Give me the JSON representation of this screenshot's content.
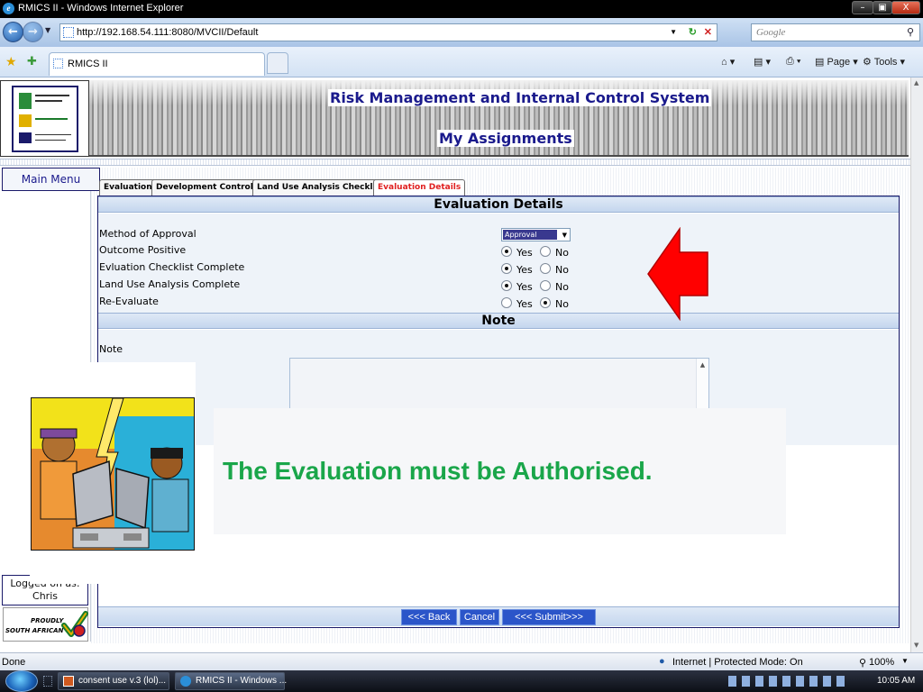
{
  "browser": {
    "window_title": "RMICS II - Windows Internet Explorer",
    "url": "http://192.168.54.111:8080/MVCII/Default",
    "search_placeholder": "Google",
    "tab_title": "RMICS II",
    "toolbar": {
      "page_label": "Page",
      "tools_label": "Tools"
    },
    "status": {
      "left": "Done",
      "zone": "Internet | Protected Mode: On",
      "zoom": "100%"
    }
  },
  "header": {
    "system_title": "Risk Management and Internal Control System",
    "page_title": "My Assignments"
  },
  "sidebar": {
    "main_menu": "Main Menu",
    "logged_on_label": "Logged on as:",
    "user": "Chris",
    "badge": {
      "line1": "PROUDLY",
      "line2": "SOUTH AFRICAN"
    }
  },
  "tabs": [
    {
      "label": "Evaluation",
      "active": false
    },
    {
      "label": "Development Controls",
      "active": false
    },
    {
      "label": "Land Use Analysis Checklist",
      "active": false
    },
    {
      "label": "Evaluation Details",
      "active": true
    }
  ],
  "evaluation_details": {
    "section_title": "Evaluation Details",
    "method_label": "Method of Approval",
    "method_value": "Approval",
    "yes_label": "Yes",
    "no_label": "No",
    "questions": [
      {
        "label": "Outcome Positive",
        "value": "Yes"
      },
      {
        "label": "Evluation Checklist Complete",
        "value": "Yes"
      },
      {
        "label": "Land Use Analysis Complete",
        "value": "Yes"
      },
      {
        "label": "Re-Evaluate",
        "value": "No"
      }
    ]
  },
  "note_section": {
    "section_title": "Note",
    "note_label": "Note",
    "note_value": ""
  },
  "buttons": {
    "back": "<<< Back",
    "cancel": "Cancel",
    "submit": "<<< Submit>>>"
  },
  "callout": {
    "message": "The Evaluation must be Authorised.",
    "color": "#1aa64a"
  },
  "taskbar": {
    "items": [
      {
        "label": "consent use v.3 (lol)..."
      },
      {
        "label": "RMICS II - Windows ..."
      }
    ],
    "clock": "10:05 AM"
  },
  "colors": {
    "accent": "#1a1a8c",
    "active_tab": "#e02020",
    "arrow": "#ff0000",
    "button": "#2b55c9"
  }
}
